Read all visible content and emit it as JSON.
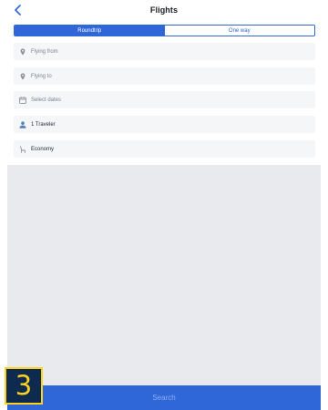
{
  "header": {
    "title": "Flights",
    "back_icon": "chevron-left-icon"
  },
  "trip_type": {
    "options": [
      "Roundtrip",
      "One way"
    ],
    "selected": "Roundtrip"
  },
  "fields": {
    "from": {
      "placeholder": "Flying from",
      "icon": "map-pin-icon"
    },
    "to": {
      "placeholder": "Flying to",
      "icon": "map-pin-icon"
    },
    "dates": {
      "placeholder": "Select dates",
      "icon": "calendar-icon"
    },
    "travelers": {
      "value": "1 Traveler",
      "icon": "person-icon"
    },
    "cabin": {
      "value": "Economy",
      "icon": "seat-icon"
    }
  },
  "search_button": {
    "label": "Search"
  },
  "step_badge": {
    "number": "3"
  },
  "colors": {
    "accent": "#2f66d8",
    "field_bg": "#f5f6f8",
    "badge_bg": "#0e2a4f",
    "badge_fg": "#ffd21f"
  }
}
